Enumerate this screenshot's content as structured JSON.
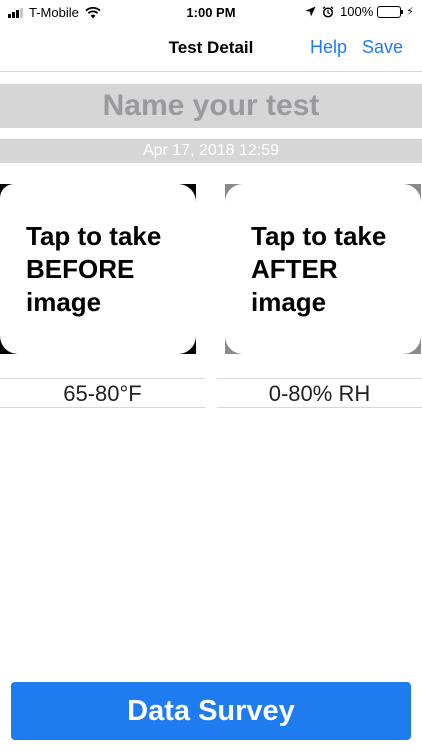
{
  "status_bar": {
    "carrier": "T-Mobile",
    "time": "1:00 PM",
    "battery": "100%",
    "icons": [
      "signal-icon",
      "wifi-icon",
      "location-icon",
      "alarm-icon",
      "battery-icon",
      "charging-icon"
    ]
  },
  "nav": {
    "title": "Test Detail",
    "help_label": "Help",
    "save_label": "Save"
  },
  "test": {
    "name_placeholder": "Name your test",
    "date": "Apr 17, 2018 12:59"
  },
  "cards": {
    "before": [
      "Tap to take",
      "BEFORE",
      "image"
    ],
    "after": [
      "Tap to take",
      "AFTER",
      "image"
    ]
  },
  "readings": {
    "temperature": "65-80°F",
    "humidity": "0-80% RH"
  },
  "actions": {
    "survey_label": "Data Survey"
  },
  "colors": {
    "accent": "#1e7cf0",
    "field_background": "#d6d6d6",
    "battery_green": "#4cd964"
  }
}
